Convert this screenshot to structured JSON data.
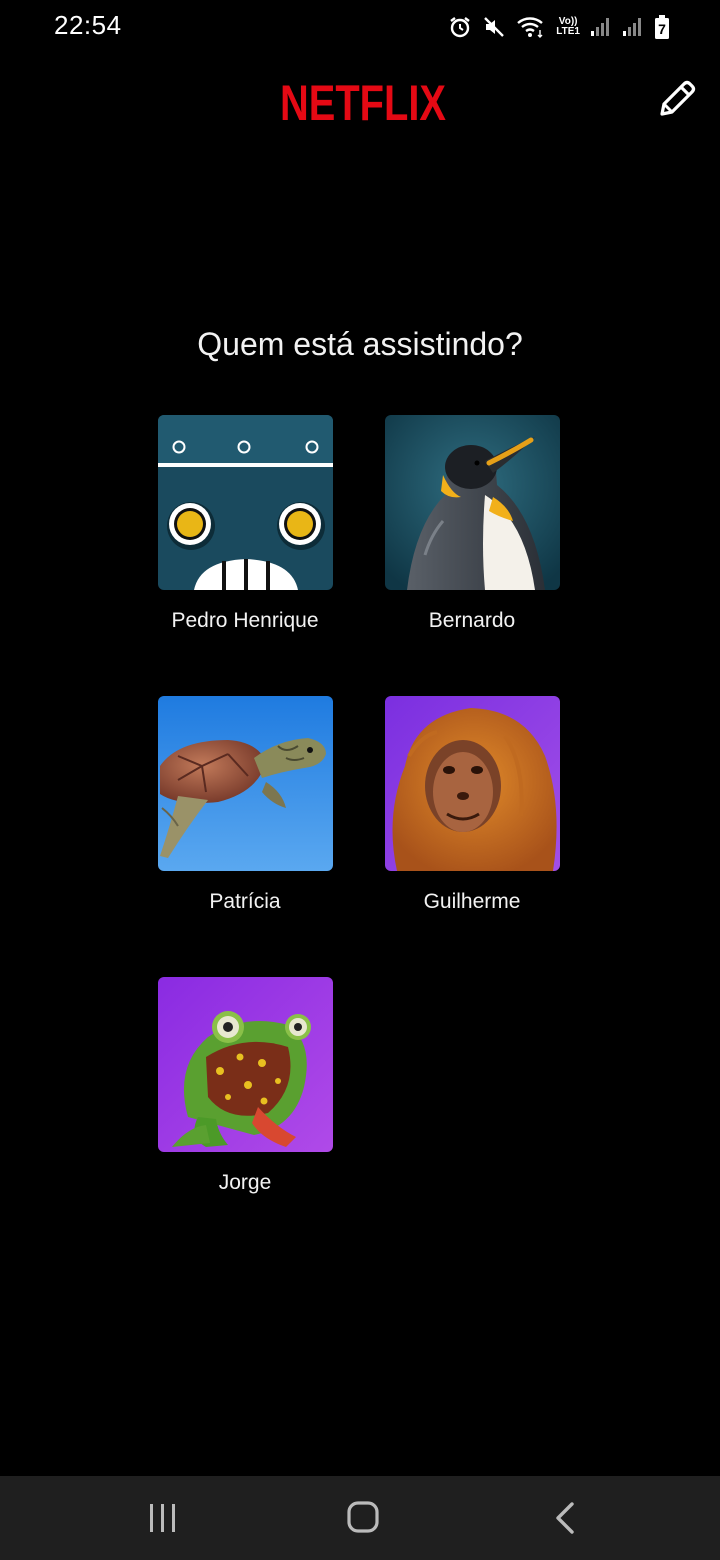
{
  "status_bar": {
    "time": "22:54",
    "network_label_top": "Vo))",
    "network_label_bottom": "LTE1",
    "battery_level": "7",
    "icons": [
      "alarm-icon",
      "mute-icon",
      "wifi-icon",
      "volte-icon",
      "signal-icon",
      "signal-icon",
      "battery-icon"
    ]
  },
  "header": {
    "logo_text": "NETFLIX",
    "brand_color": "#e50914",
    "edit_icon": "pencil-icon"
  },
  "page_title": "Quem está assistindo?",
  "profiles": [
    {
      "name": "Pedro Henrique",
      "avatar": "robot-avatar"
    },
    {
      "name": "Bernardo",
      "avatar": "penguin-avatar"
    },
    {
      "name": "Patrícia",
      "avatar": "turtle-avatar"
    },
    {
      "name": "Guilherme",
      "avatar": "orangutan-avatar"
    },
    {
      "name": "Jorge",
      "avatar": "frog-avatar"
    }
  ],
  "nav_bar": {
    "buttons": [
      "recent-apps-icon",
      "home-icon",
      "back-icon"
    ]
  }
}
